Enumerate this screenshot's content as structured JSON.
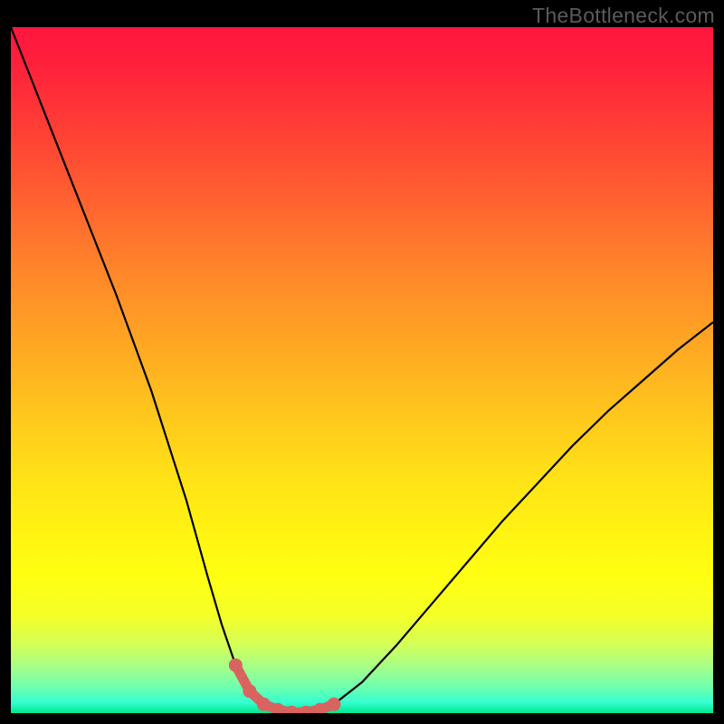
{
  "watermark": "TheBottleneck.com",
  "chart_data": {
    "type": "line",
    "title": "",
    "xlabel": "",
    "ylabel": "",
    "xlim": [
      0,
      100
    ],
    "ylim": [
      0,
      100
    ],
    "series": [
      {
        "name": "curve",
        "x": [
          0,
          5,
          10,
          15,
          20,
          25,
          28,
          30,
          32,
          34,
          36,
          38,
          40,
          42,
          44,
          46,
          50,
          55,
          60,
          65,
          70,
          75,
          80,
          85,
          90,
          95,
          100
        ],
        "y": [
          100,
          87,
          74,
          61,
          47,
          31,
          20,
          13,
          7,
          3.2,
          1.3,
          0.5,
          0.1,
          0.1,
          0.5,
          1.3,
          4.5,
          10,
          16,
          22,
          28,
          33.5,
          39,
          44,
          48.5,
          53,
          57
        ]
      },
      {
        "name": "highlight-zone",
        "x": [
          32,
          34,
          36,
          38,
          40,
          42,
          44,
          46
        ],
        "y": [
          7,
          3.2,
          1.3,
          0.5,
          0.1,
          0.1,
          0.5,
          1.3
        ]
      }
    ],
    "gradient_stops": [
      {
        "offset": 0.0,
        "color": "#ff163f"
      },
      {
        "offset": 0.05,
        "color": "#ff1f3c"
      },
      {
        "offset": 0.15,
        "color": "#ff3f35"
      },
      {
        "offset": 0.25,
        "color": "#ff6130"
      },
      {
        "offset": 0.35,
        "color": "#ff842a"
      },
      {
        "offset": 0.45,
        "color": "#ffa324"
      },
      {
        "offset": 0.55,
        "color": "#ffc21e"
      },
      {
        "offset": 0.65,
        "color": "#ffe017"
      },
      {
        "offset": 0.73,
        "color": "#fff213"
      },
      {
        "offset": 0.8,
        "color": "#ffff11"
      },
      {
        "offset": 0.86,
        "color": "#f3ff29"
      },
      {
        "offset": 0.9,
        "color": "#d4ff57"
      },
      {
        "offset": 0.93,
        "color": "#a9ff85"
      },
      {
        "offset": 0.96,
        "color": "#73ffad"
      },
      {
        "offset": 0.985,
        "color": "#33ffcf"
      },
      {
        "offset": 1.0,
        "color": "#00e58b"
      }
    ],
    "colors": {
      "curve": "#000000",
      "highlight_stroke": "#d9635f",
      "highlight_marker": "#d9635f"
    }
  }
}
